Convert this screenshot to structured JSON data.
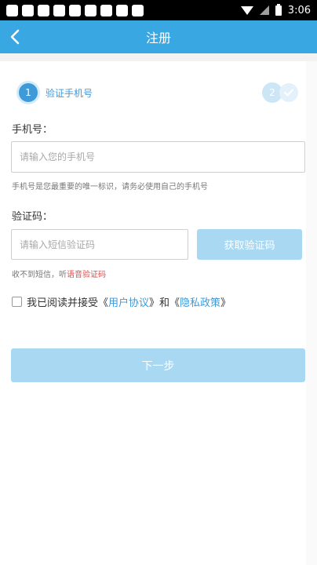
{
  "status_bar": {
    "time": "3:06",
    "icons": [
      "notification-icon",
      "notification-icon",
      "notification-icon",
      "notification-icon",
      "notification-icon",
      "notification-icon",
      "notification-icon",
      "notification-icon",
      "notification-icon"
    ]
  },
  "nav": {
    "title": "注册",
    "back_icon": "chevron-left-icon"
  },
  "steps": {
    "current_number": "1",
    "current_label": "验证手机号",
    "next_number": "2",
    "done_icon": "check-icon"
  },
  "phone": {
    "label": "手机号：",
    "placeholder": "请输入您的手机号",
    "value": "",
    "hint": "手机号是您最重要的唯一标识，请务必使用自己的手机号"
  },
  "code": {
    "label": "验证码：",
    "placeholder": "请输入短信验证码",
    "value": "",
    "button_label": "获取验证码",
    "hint_prefix": "收不到短信，听",
    "hint_link": "语音验证码"
  },
  "agreement": {
    "text_before": "我已阅读并接受《",
    "link1": "用户协议",
    "text_mid": "》和《",
    "link2": "隐私政策",
    "text_after": "》",
    "checked": false
  },
  "next_button": {
    "label": "下一步"
  },
  "colors": {
    "accent": "#38a7e2",
    "accent_disabled": "#a9d8f2",
    "warning_link": "#e04b4b"
  }
}
